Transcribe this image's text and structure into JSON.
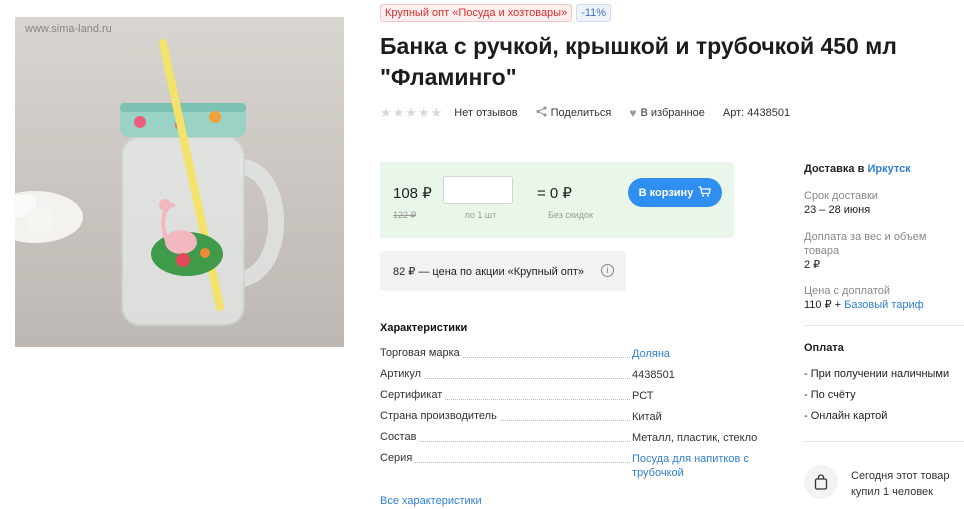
{
  "image": {
    "watermark": "www.sima-land.ru"
  },
  "badges": {
    "wholesale": "Крупный опт «Посуда и хозтовары»",
    "discount": "-11%"
  },
  "product": {
    "title": "Банка с ручкой, крышкой и трубочкой 450 мл \"Фламинго\"",
    "rating_stars": 0,
    "reviews": "Нет отзывов",
    "share": "Поделиться",
    "favorite": "В избранное",
    "article": "Арт: 4438501"
  },
  "price": {
    "current": "108 ₽",
    "old": "122 ₽",
    "qty_value": "",
    "qty_note": "по 1 шт",
    "total": "= 0 ₽",
    "total_note": "Без скидок",
    "cart_label": "В корзину"
  },
  "promo": {
    "text": "82 ₽ — цена по акции «Крупный опт»",
    "info_icon": "info-icon"
  },
  "characteristics": {
    "title": "Характеристики",
    "rows": [
      {
        "key": "Торговая марка",
        "value": "Доляна",
        "link": true
      },
      {
        "key": "Артикул",
        "value": "4438501",
        "link": false
      },
      {
        "key": "Сертификат",
        "value": "РСТ",
        "link": false
      },
      {
        "key": "Страна производитель",
        "value": "Китай",
        "link": false
      },
      {
        "key": "Состав",
        "value": "Металл, пластик, стекло",
        "link": false
      },
      {
        "key": "Серия",
        "value": "Посуда для напитков с трубочкой",
        "link": true
      }
    ],
    "all_link": "Все характеристики"
  },
  "delivery": {
    "heading": "Доставка в",
    "city": "Иркутск",
    "term_label": "Срок доставки",
    "term_value": "23 – 28 июня",
    "surcharge_label": "Доплата за вес и объем товара",
    "surcharge_value": "2 ₽",
    "with_surcharge_label": "Цена с доплатой",
    "with_surcharge_value": "110 ₽ +",
    "tariff_link": "Базовый тариф"
  },
  "payment": {
    "heading": "Оплата",
    "items": [
      "- При получении наличными",
      "- По счёту",
      "- Онлайн картой"
    ]
  },
  "bought": {
    "text": "Сегодня этот товар купил 1 человек",
    "icon": "shopping-bag-icon"
  },
  "colors": {
    "accent": "#2f8ff0",
    "link": "#2f7fd6",
    "price_bg": "#e9f6e9",
    "badge_red": "#d53030"
  }
}
